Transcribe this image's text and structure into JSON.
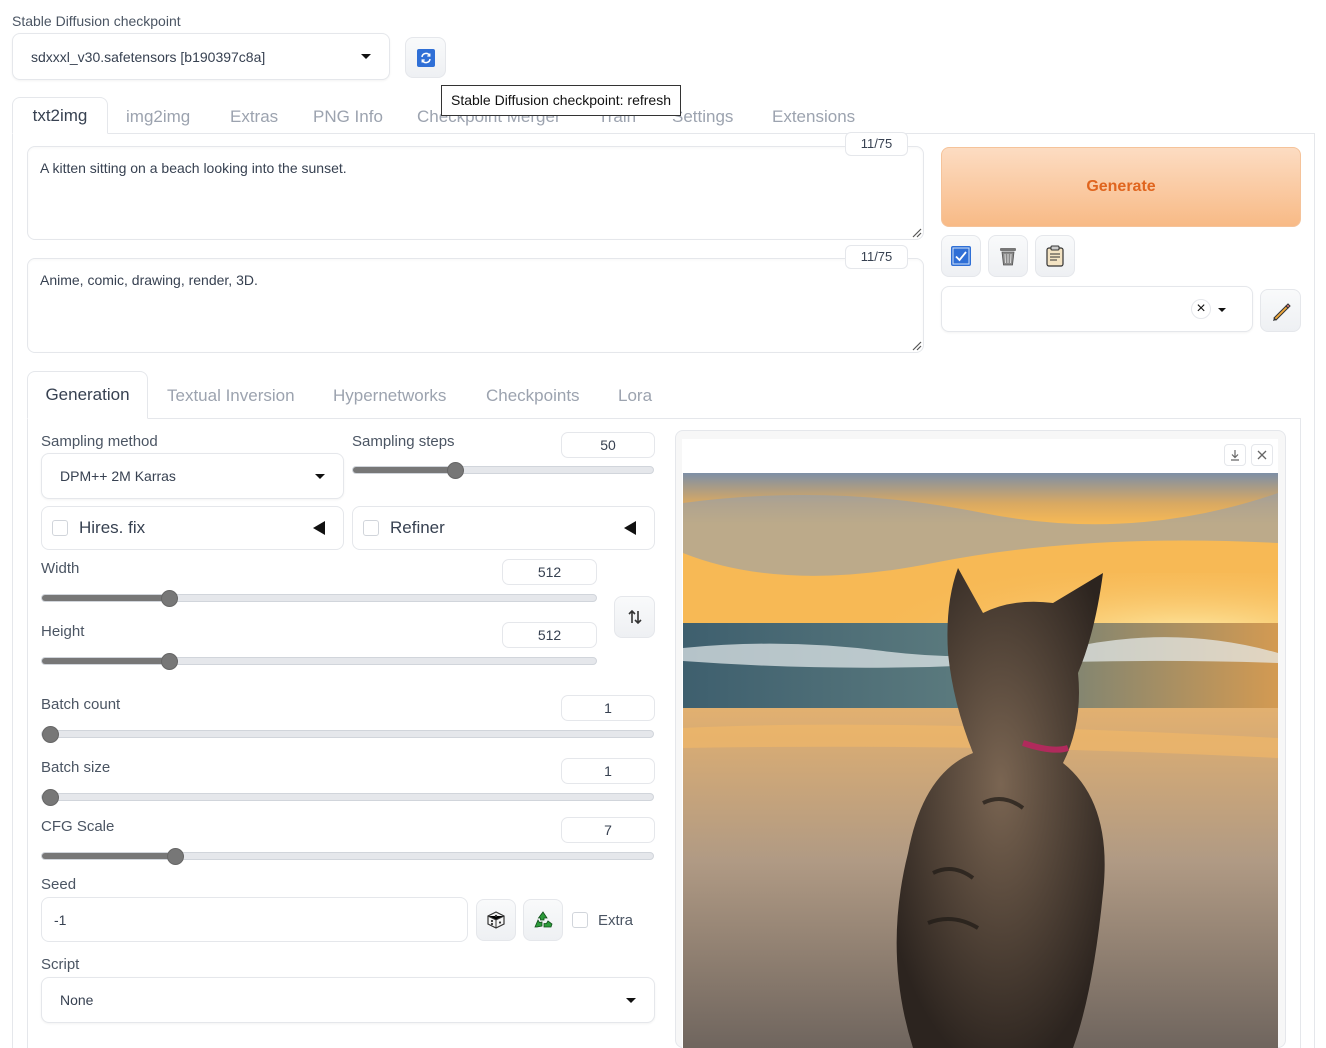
{
  "checkpoint": {
    "label": "Stable Diffusion checkpoint",
    "value": "sdxxxl_v30.safetensors [b190397c8a]",
    "tooltip": "Stable Diffusion checkpoint: refresh"
  },
  "main_tabs": [
    {
      "label": "txt2img",
      "active": true
    },
    {
      "label": "img2img"
    },
    {
      "label": "Extras"
    },
    {
      "label": "PNG Info"
    },
    {
      "label": "Checkpoint Merger"
    },
    {
      "label": "Train"
    },
    {
      "label": "Settings"
    },
    {
      "label": "Extensions"
    }
  ],
  "prompt": {
    "text": "A kitten sitting on a beach looking into the sunset.",
    "counter": "11/75"
  },
  "negative_prompt": {
    "text": "Anime, comic, drawing, render, 3D.",
    "counter": "11/75"
  },
  "generate_label": "Generate",
  "styles": {
    "clear_symbol": "×"
  },
  "sub_tabs": [
    {
      "label": "Generation",
      "active": true
    },
    {
      "label": "Textual Inversion"
    },
    {
      "label": "Hypernetworks"
    },
    {
      "label": "Checkpoints"
    },
    {
      "label": "Lora"
    }
  ],
  "sampling_method": {
    "label": "Sampling method",
    "value": "DPM++ 2M Karras"
  },
  "sampling_steps": {
    "label": "Sampling steps",
    "value": "50",
    "fraction": 0.34
  },
  "hires_fix": {
    "label": "Hires. fix",
    "checked": false
  },
  "refiner": {
    "label": "Refiner",
    "checked": false
  },
  "width": {
    "label": "Width",
    "value": "512",
    "fraction": 0.23
  },
  "height": {
    "label": "Height",
    "value": "512",
    "fraction": 0.23
  },
  "batch_count": {
    "label": "Batch count",
    "value": "1",
    "fraction": 0.0
  },
  "batch_size": {
    "label": "Batch size",
    "value": "1",
    "fraction": 0.0
  },
  "cfg_scale": {
    "label": "CFG Scale",
    "value": "7",
    "fraction": 0.217
  },
  "seed": {
    "label": "Seed",
    "value": "-1",
    "extra_label": "Extra"
  },
  "script": {
    "label": "Script",
    "value": "None"
  },
  "colors": {
    "generate_top": "#fcdcc2",
    "generate_bottom": "#f8ba86",
    "generate_text": "#e0651e",
    "accent_blue": "#2f6fd6",
    "slider": "#777777"
  },
  "icons": {
    "refresh": "refresh-icon",
    "check": "checkbox-icon",
    "trash": "trash-icon",
    "clipboard": "clipboard-icon",
    "pencil": "pencil-icon",
    "swap": "swap-icon",
    "dice": "dice-icon",
    "recycle": "recycle-icon",
    "download": "download-icon",
    "close": "close-icon"
  }
}
